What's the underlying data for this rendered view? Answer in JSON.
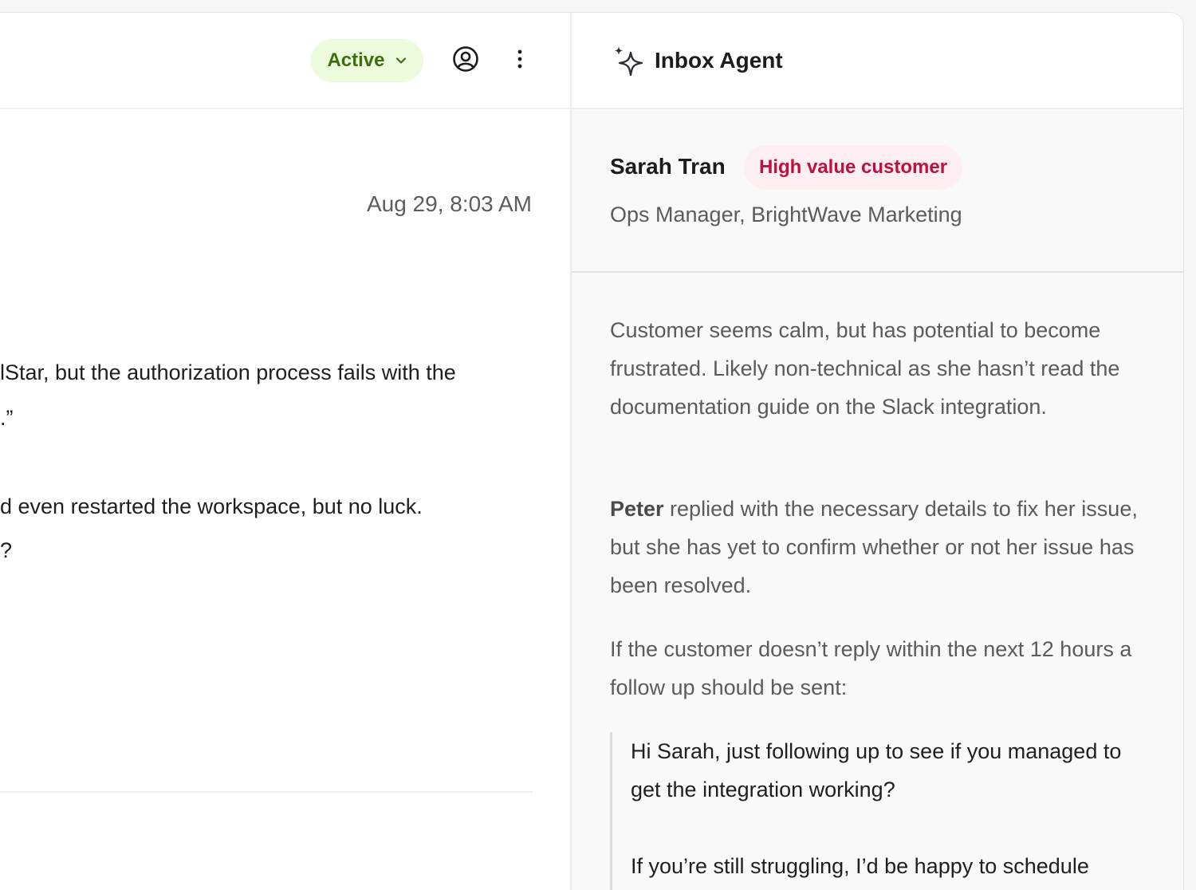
{
  "conversation": {
    "status_label": "Active",
    "timestamp": "Aug 29, 8:03 AM",
    "message_lines": [
      "lStar, but the authorization process fails with the",
      ".”",
      "d even restarted the workspace, but no luck.",
      "?"
    ]
  },
  "agent": {
    "title": "Inbox Agent",
    "customer": {
      "name": "Sarah Tran",
      "badge": "High value customer",
      "role": "Ops Manager, BrightWave Marketing"
    },
    "summary_1": "Customer seems calm, but has potential to become frustrated. Likely non-technical as she hasn’t read the documentation guide on the Slack integration.",
    "summary_2_name": "Peter",
    "summary_2_rest": " replied with the necessary details to fix her issue, but she has yet to confirm whether or not her issue has been resolved.",
    "summary_3": "If the customer doesn’t reply within the next 12 hours a follow up should be sent:",
    "followup_line_1": "Hi Sarah, just following up to see if you managed to get the integration working?",
    "followup_line_2": "If you’re still struggling, I’d be happy to schedule"
  },
  "colors": {
    "active_bg": "#ecfbdc",
    "active_text": "#3c6e0d",
    "badge_bg": "#fdeef1",
    "badge_text": "#c0103f"
  },
  "icons": [
    "chevron-down-icon",
    "user-circle-icon",
    "more-vertical-icon",
    "sparkle-icon"
  ]
}
